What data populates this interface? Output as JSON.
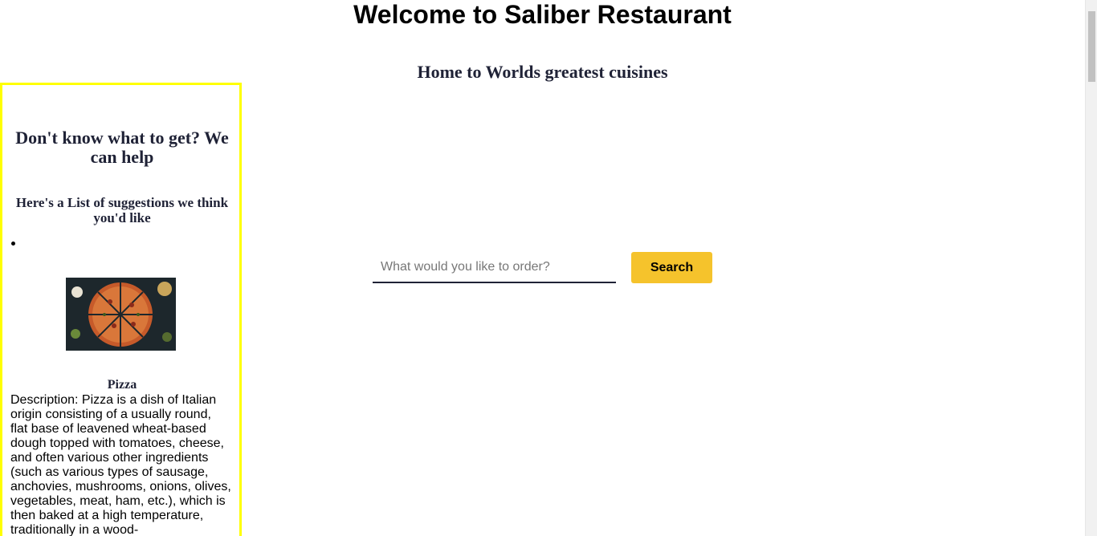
{
  "header": {
    "title": "Welcome to Saliber Restaurant",
    "subtitle": "Home to Worlds greatest cuisines"
  },
  "sidebar": {
    "heading": "Don't know what to get? We can help",
    "subheading": "Here's a List of suggestions we think you'd like",
    "items": [
      {
        "image": "pizza-photo",
        "name": "Pizza",
        "description": "Description: Pizza is a dish of Italian origin consisting of a usually round, flat base of leavened wheat-based dough topped with tomatoes, cheese, and often various other ingredients (such as various types of sausage, anchovies, mushrooms, onions, olives, vegetables, meat, ham, etc.), which is then baked at a high temperature, traditionally in a wood-"
      }
    ]
  },
  "search": {
    "placeholder": "What would you like to order?",
    "value": "",
    "button_label": "Search"
  },
  "colors": {
    "sidebar_border": "#ffff00",
    "search_button": "#f5c32c",
    "heading_text": "#1f2236"
  }
}
